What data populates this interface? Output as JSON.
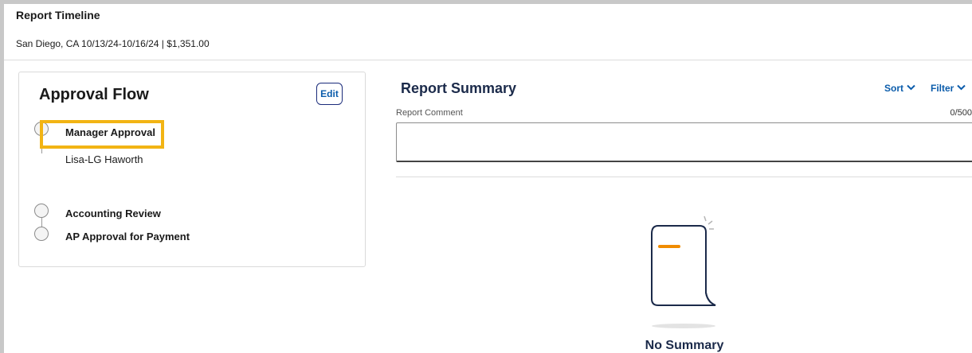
{
  "header": {
    "title": "Report Timeline",
    "subtitle": "San Diego, CA 10/13/24-10/16/24 | $1,351.00"
  },
  "approval_flow": {
    "title": "Approval Flow",
    "edit_label": "Edit",
    "highlight_color": "#f2b414",
    "steps": [
      {
        "label": "Manager Approval",
        "approver": "Lisa-LG Haworth",
        "highlighted": true
      },
      {
        "label": "Accounting Review"
      },
      {
        "label": "AP Approval for Payment"
      }
    ]
  },
  "report_summary": {
    "title": "Report Summary",
    "sort_label": "Sort",
    "filter_label": "Filter",
    "comment_label": "Report Comment",
    "comment_count": "0/500",
    "comment_value": "",
    "empty_state": {
      "icon": "document-empty-icon",
      "accent_color": "#f08c00",
      "text": "No Summary"
    }
  },
  "colors": {
    "link": "#0b5cab",
    "frame": "#c8c8c8"
  }
}
